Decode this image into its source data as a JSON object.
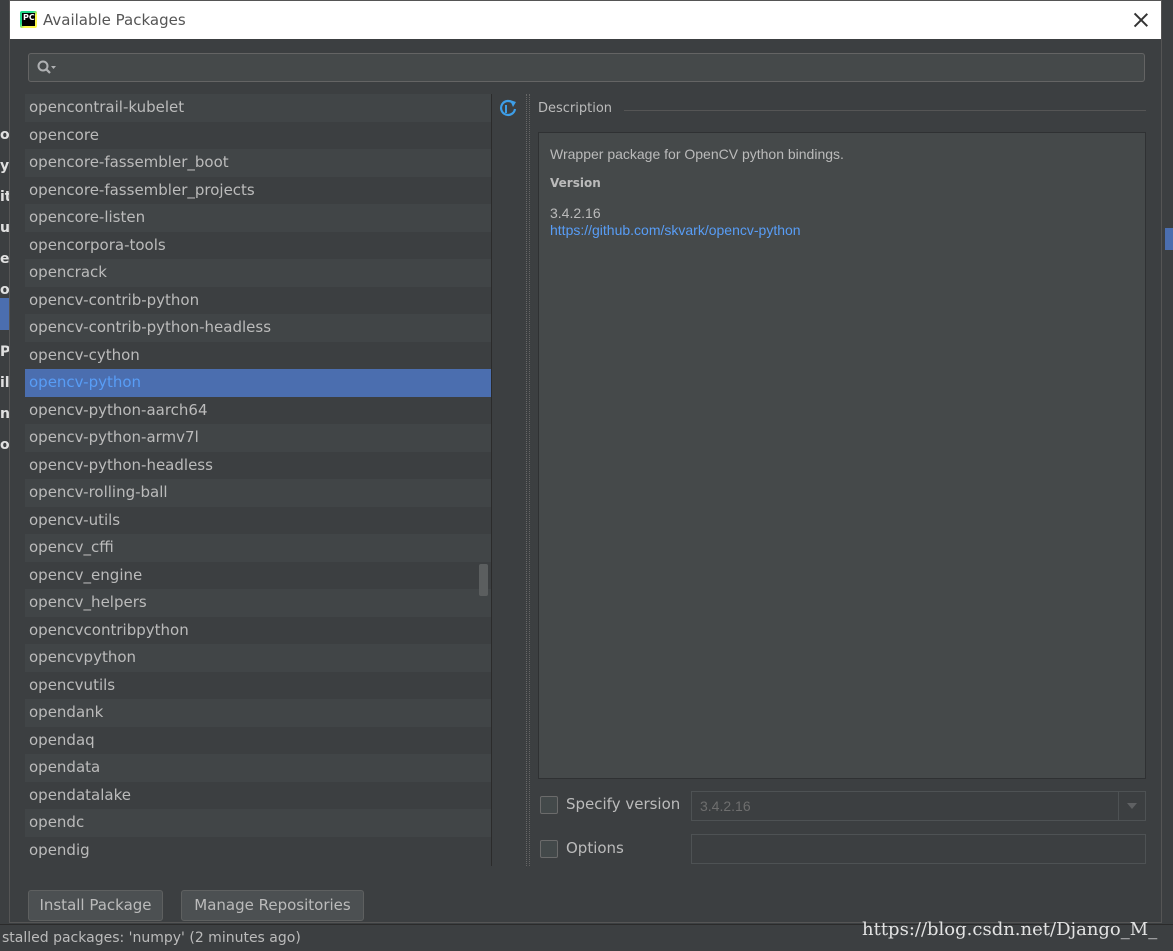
{
  "dialog": {
    "title": "Available Packages",
    "app_icon_text": "PC"
  },
  "search": {
    "value": "",
    "placeholder": ""
  },
  "packages": [
    "opencontrail-kubelet",
    "opencore",
    "opencore-fassembler_boot",
    "opencore-fassembler_projects",
    "opencore-listen",
    "opencorpora-tools",
    "opencrack",
    "opencv-contrib-python",
    "opencv-contrib-python-headless",
    "opencv-cython",
    "opencv-python",
    "opencv-python-aarch64",
    "opencv-python-armv7l",
    "opencv-python-headless",
    "opencv-rolling-ball",
    "opencv-utils",
    "opencv_cffi",
    "opencv_engine",
    "opencv_helpers",
    "opencvcontribpython",
    "opencvpython",
    "opencvutils",
    "opendank",
    "opendaq",
    "opendata",
    "opendatalake",
    "opendc",
    "opendig"
  ],
  "selected_package": "opencv-python",
  "description": {
    "header": "Description",
    "summary": "Wrapper package for OpenCV python bindings.",
    "version_label": "Version",
    "version": "3.4.2.16",
    "link": "https://github.com/skvark/opencv-python"
  },
  "specify_version": {
    "label": "Specify version",
    "checked": false,
    "value": "3.4.2.16"
  },
  "options": {
    "label": "Options",
    "checked": false,
    "value": ""
  },
  "buttons": {
    "install": "Install Package",
    "manage": "Manage Repositories"
  },
  "background": {
    "letters": [
      "op",
      "y",
      "it",
      "ug",
      "er",
      "o.",
      "P",
      "P",
      "il",
      "n",
      "o"
    ],
    "status_text": "stalled packages: 'numpy' (2 minutes ago)"
  },
  "watermark": "https://blog.csdn.net/Django_M_",
  "colors": {
    "selection": "#4b6eaf",
    "link": "#589df6",
    "text": "#bbbbbb"
  }
}
